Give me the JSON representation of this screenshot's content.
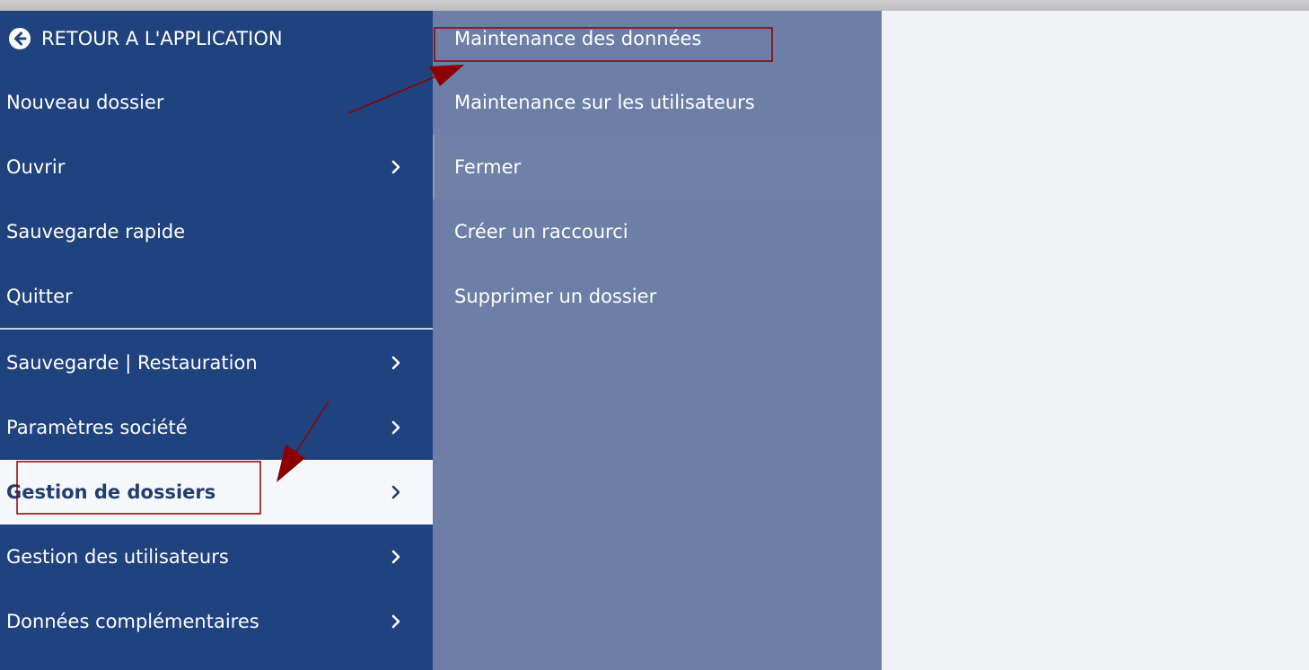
{
  "left_menu": {
    "back_label": "RETOUR A L'APPLICATION",
    "items": [
      {
        "label": "Nouveau dossier"
      },
      {
        "label": "Ouvrir"
      },
      {
        "label": "Sauvegarde rapide"
      },
      {
        "label": "Quitter"
      },
      {
        "label": "Sauvegarde | Restauration"
      },
      {
        "label": "Paramètres société"
      },
      {
        "label": "Gestion de dossiers"
      },
      {
        "label": "Gestion des utilisateurs"
      },
      {
        "label": "Données complémentaires"
      }
    ]
  },
  "sub_menu": {
    "items": [
      {
        "label": "Maintenance des données"
      },
      {
        "label": "Maintenance sur les utilisateurs"
      },
      {
        "label": "Fermer"
      },
      {
        "label": "Créer un raccourci"
      },
      {
        "label": "Supprimer un dossier"
      }
    ]
  },
  "colors": {
    "menu_bg": "#20437f",
    "submenu_bg": "#6d7fa7",
    "active_bg": "#f6f7fa",
    "active_text": "#233d6e",
    "annotation": "#8b0000"
  },
  "icons": {
    "back": "arrow-left-circle-icon",
    "expand": "chevron-right-icon"
  }
}
